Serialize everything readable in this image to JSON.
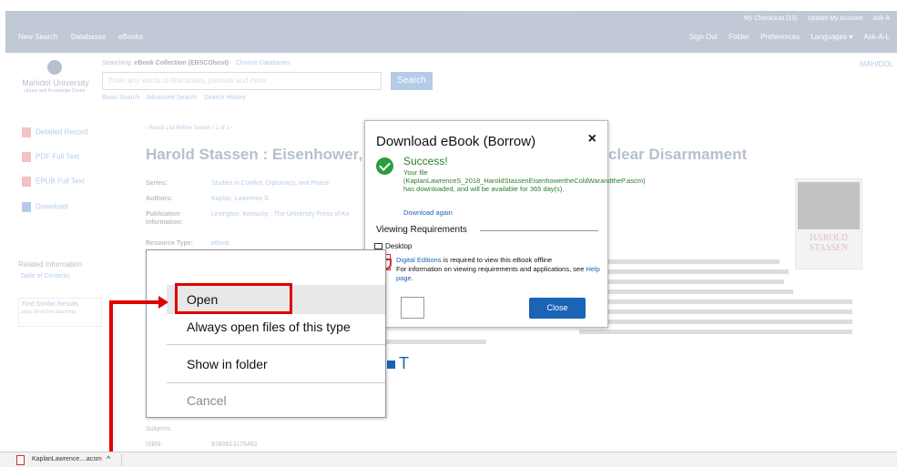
{
  "topbar": {
    "user_links": [
      "My Checkouts (10)",
      "Update My Account",
      "Ask-A"
    ],
    "nav_left": [
      "New Search",
      "Databases",
      "eBooks"
    ],
    "nav_right": [
      "Sign Out",
      "Folder",
      "Preferences",
      "Languages ▾",
      "Ask-A-L"
    ]
  },
  "institution": {
    "name": "Mahidol University",
    "subtitle": "Library and Knowledge Center"
  },
  "search": {
    "searching_prefix": "Searching:",
    "collection": "eBook Collection (EBSCOhost)",
    "choose_databases": "Choose Databases",
    "placeholder": "Enter any words to find books, journals and more",
    "button": "Search",
    "links": [
      "Basic Search",
      "Advanced Search",
      "Search History"
    ]
  },
  "corner_link": "MAHIDOL",
  "sidebar": {
    "items": [
      "Detailed Record",
      "PDF Full Text",
      "EPUB Full Text",
      "Download"
    ],
    "related_heading": "Related Information",
    "table_of_contents": "Table of Contents",
    "find_similar": "Find Similar Results",
    "find_similar_sub": "using SmartText Searching."
  },
  "record": {
    "breadcrumb": "‹ Result List   Refine Search   ‹ 1 of 1 ›",
    "title_start": "Harold Stassen : Eisenhower, th",
    "title_end": "clear Disarmament",
    "meta": [
      {
        "label": "Series:",
        "value": "Studies in Conflict, Diplomacy, and Peace"
      },
      {
        "label": "Authors:",
        "value": "Kaplan, Lawrence S."
      },
      {
        "label": "Publication",
        "value": "Lexington, Kentucky : The University Press of Ke"
      },
      {
        "label": "Information:",
        "value": ""
      },
      {
        "label": "Resource Type:",
        "value": "eBook"
      }
    ],
    "cover_text": "HAROLD STASSEN",
    "bottom_meta": [
      {
        "label": "Subjects:",
        "value": ""
      },
      {
        "label": "ISBN:",
        "value": "9780813176482"
      }
    ]
  },
  "modal": {
    "title": "Download eBook (Borrow)",
    "close_icon": "×",
    "success": "Success!",
    "message": "Your file (KaplanLawrenceS_2018_HaroldStassenEisenhowertheColdWarandtheP.ascm) has downloaded, and will be available for 365 day(s).",
    "download_again": "Download again",
    "section": "Viewing Requirements",
    "desktop": "Desktop",
    "req_link": "Digital Editions",
    "req_text": " is required to view this eBook offline",
    "info_prefix": "For information on viewing requirements and applications, see ",
    "info_link": "Help page.",
    "close_button": "Close"
  },
  "context_menu": {
    "items": [
      "Open",
      "Always open files of this type",
      "Show in folder",
      "Cancel"
    ]
  },
  "download_bar": {
    "filename": "KaplanLawrence....acsm",
    "caret": "^"
  },
  "colors": {
    "highlight": "#e00000",
    "brand_blue": "#1a63b5",
    "success_green": "#2a9d3a"
  }
}
